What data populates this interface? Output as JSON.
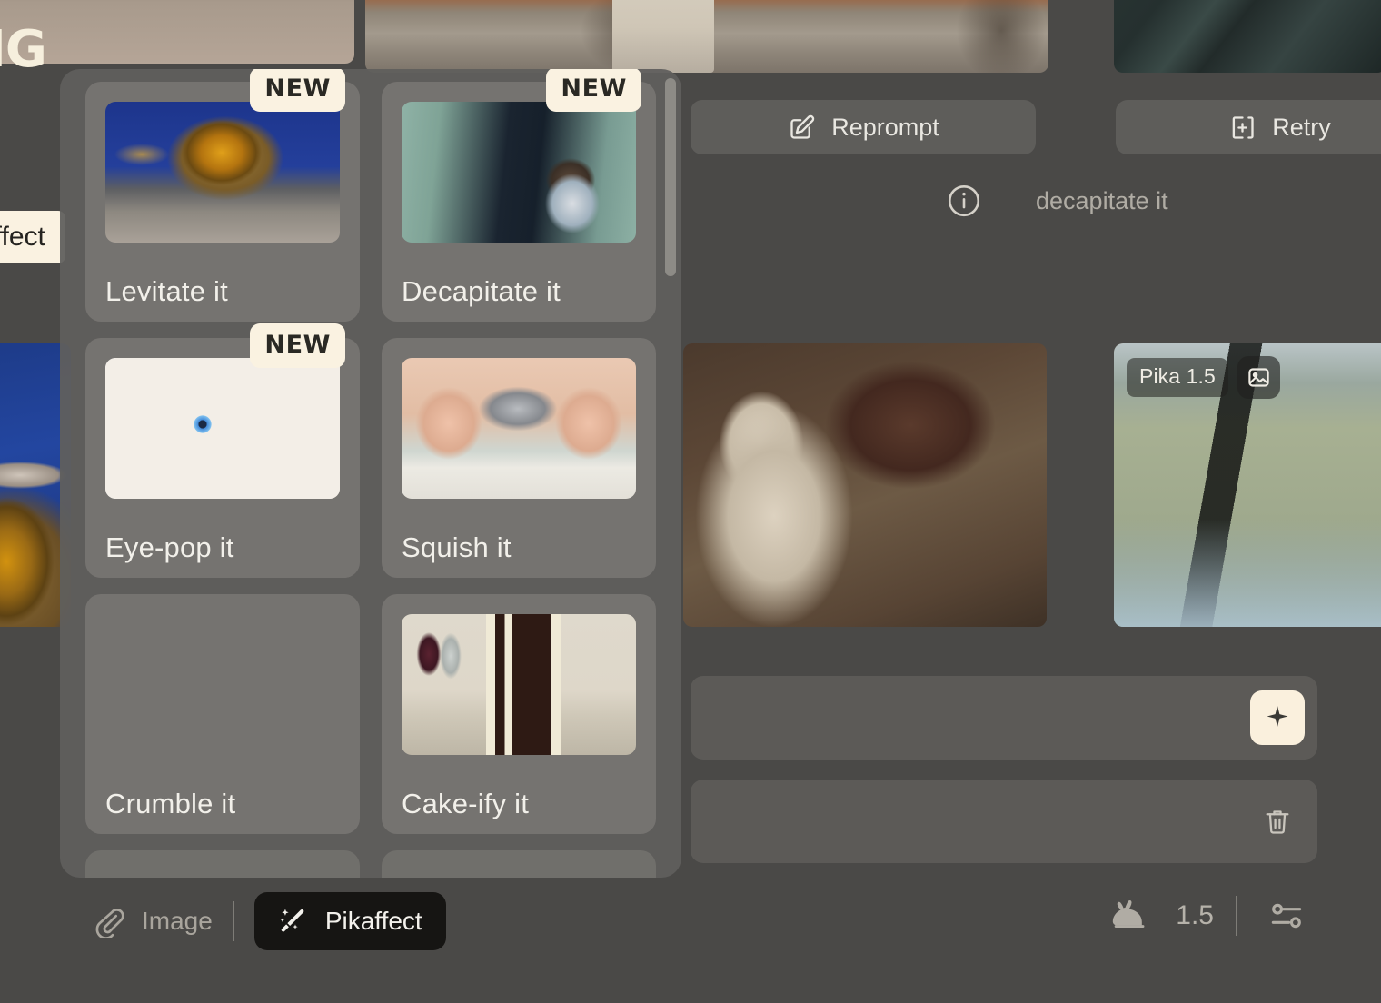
{
  "app": {
    "background_color": "#4a4947",
    "accent_cream": "#faf2e1",
    "panel_color": "#605f5c",
    "card_color": "#7c7a76"
  },
  "stray_ui": {
    "logo_fragment": "IG",
    "pikaffect_tag_fragment": "kaffect"
  },
  "actions": {
    "reprompt_label": "Reprompt",
    "reprompt_icon": "edit-square-icon",
    "retry_label": "Retry",
    "retry_icon": "add-to-frame-icon",
    "info_icon": "info-circle-icon",
    "prompt_text": "decapitate it"
  },
  "thumbnail_meta": {
    "model_label": "Pika 1.5",
    "image_icon": "image-icon"
  },
  "composer": {
    "generate_icon": "sparkle-icon",
    "delete_icon": "trash-icon"
  },
  "bottom_bar": {
    "attach_icon": "paperclip-icon",
    "attach_label": "Image",
    "pikaffect_icon": "magic-wand-icon",
    "pikaffect_label": "Pikaffect",
    "speed_icon": "rabbit-icon",
    "version_label": "1.5",
    "settings_icon": "sliders-icon"
  },
  "picker": {
    "scrollbar": {
      "visible": true
    },
    "effects": [
      {
        "id": "levitate",
        "label": "Levitate it",
        "badge": "NEW",
        "art": "art-levitate",
        "thumb_name": "levitating-pumpkin-thumbnail"
      },
      {
        "id": "decapitate",
        "label": "Decapitate it",
        "badge": "NEW",
        "art": "art-decapitate",
        "thumb_name": "decapitated-girl-hallway-thumbnail"
      },
      {
        "id": "eyepop",
        "label": "Eye-pop it",
        "badge": "NEW",
        "art": "art-eyepop",
        "thumb_name": "cat-bulging-eyes-thumbnail"
      },
      {
        "id": "squish",
        "label": "Squish it",
        "badge": "",
        "art": "art-squish",
        "thumb_name": "hands-squishing-object-thumbnail"
      },
      {
        "id": "crumble",
        "label": "Crumble it",
        "badge": "",
        "art": "art-crumble",
        "thumb_name": "crumbling-statues-thumbnail"
      },
      {
        "id": "cakeify",
        "label": "Cake-ify it",
        "badge": "",
        "art": "art-cakeify",
        "thumb_name": "cake-slice-thumbnail"
      }
    ]
  }
}
